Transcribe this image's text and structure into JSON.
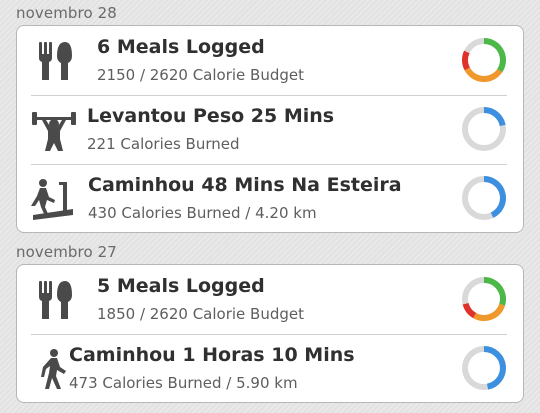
{
  "days": [
    {
      "date": "novembro 28",
      "entries": [
        {
          "icon": "fork-knife-icon",
          "title": "6 Meals Logged",
          "subtitle": "2150 / 2620 Calorie Budget",
          "ring": "meal",
          "progress": 0.82
        },
        {
          "icon": "weightlifter-icon",
          "title": "Levantou Peso 25 Mins",
          "subtitle": "221 Calories Burned",
          "ring": "exercise",
          "progress": 0.22
        },
        {
          "icon": "treadmill-icon",
          "title": "Caminhou 48 Mins Na Esteira",
          "subtitle": "430 Calories Burned / 4.20 km",
          "ring": "exercise",
          "progress": 0.43
        }
      ]
    },
    {
      "date": "novembro 27",
      "entries": [
        {
          "icon": "fork-knife-icon",
          "title": "5 Meals Logged",
          "subtitle": "1850 / 2620 Calorie Budget",
          "ring": "meal",
          "progress": 0.71
        },
        {
          "icon": "walking-person-icon",
          "title": "Caminhou 1 Horas 10 Mins",
          "subtitle": "473 Calories Burned / 5.90 km",
          "ring": "exercise",
          "progress": 0.47
        }
      ]
    }
  ],
  "colors": {
    "ring_track": "#d9d9d9",
    "ring_blue": "#3d8fe0",
    "ring_green": "#4cb847",
    "ring_orange": "#f0982b",
    "ring_red": "#e0312b",
    "icon": "#4a4a4a"
  }
}
